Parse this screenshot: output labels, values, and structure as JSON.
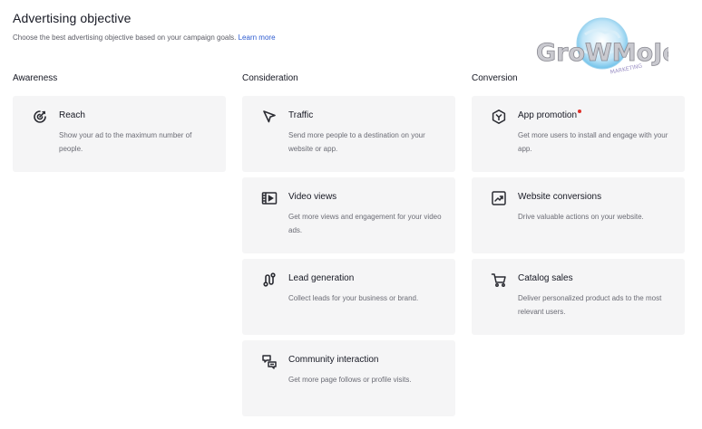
{
  "header": {
    "title": "Advertising objective",
    "subtitle": "Choose the best advertising objective based on your campaign goals.",
    "learn_more": "Learn more"
  },
  "logo": {
    "text": "GroWMoJo",
    "subtext": "MARKETING"
  },
  "columns": [
    {
      "heading": "Awareness",
      "cards": [
        {
          "name": "Reach",
          "icon": "reach-icon",
          "desc": "Show your ad to the maximum number of people."
        }
      ]
    },
    {
      "heading": "Consideration",
      "cards": [
        {
          "name": "Traffic",
          "icon": "cursor-arrow-icon",
          "desc": "Send more people to a destination on your website or app."
        },
        {
          "name": "Video views",
          "icon": "video-icon",
          "desc": "Get more views and engagement for your video ads."
        },
        {
          "name": "Lead generation",
          "icon": "lead-funnel-icon",
          "desc": "Collect leads for your business or brand."
        },
        {
          "name": "Community interaction",
          "icon": "community-icon",
          "desc": "Get more page follows or profile visits."
        }
      ]
    },
    {
      "heading": "Conversion",
      "cards": [
        {
          "name": "App promotion",
          "icon": "app-cube-icon",
          "desc": "Get more users to install and engage with your app.",
          "new_badge": true
        },
        {
          "name": "Website conversions",
          "icon": "conversion-chart-icon",
          "desc": "Drive valuable actions on your website."
        },
        {
          "name": "Catalog sales",
          "icon": "shopping-cart-icon",
          "desc": "Deliver personalized product ads to the most relevant users."
        }
      ]
    }
  ],
  "colors": {
    "card_bg": "#f5f5f6",
    "link": "#2d5bd0",
    "badge": "#e0312b",
    "text": "#161823"
  }
}
